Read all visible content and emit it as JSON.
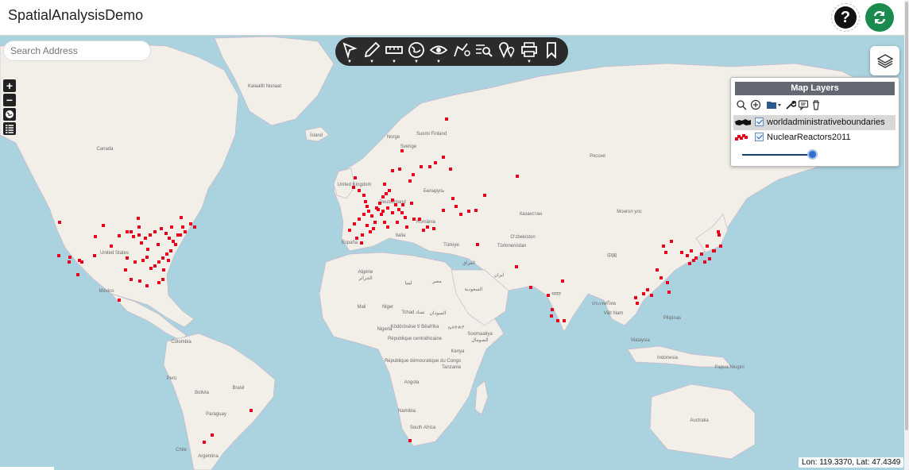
{
  "app": {
    "title": "SpatialAnalysisDemo"
  },
  "header": {
    "help_icon": "help-icon",
    "refresh_icon": "refresh-icon",
    "accent": "#1a8a4e"
  },
  "search": {
    "placeholder": "Search Address"
  },
  "toolbar": {
    "tools": [
      "select-tool-icon",
      "draw-tool-icon",
      "measure-tool-icon",
      "globe-tool-icon",
      "view-tool-icon",
      "buffer-tool-icon",
      "identify-tool-icon",
      "location-tool-icon",
      "print-tool-icon",
      "bookmark-tool-icon"
    ]
  },
  "map_controls": {
    "zoom_in": "+",
    "zoom_out": "−"
  },
  "layers": {
    "title": "Map Layers",
    "items": [
      {
        "name": "worldadministrativeboundaries",
        "checked": true
      },
      {
        "name": "NuclearReactors2011",
        "checked": true
      }
    ],
    "opacity_slider": 1.0
  },
  "coords": {
    "text": "Lon: 119.3370, Lat: 47.4349"
  },
  "map_labels": {
    "canada": "Canada",
    "kalaallit": "Kalaallit Nunaat",
    "island": "Ísland",
    "norge": "Norge",
    "suomi": "Suomi Finland",
    "sverige": "Sverige",
    "uk": "United Kingdom",
    "belarus": "Беларусь",
    "deutschland": "Deutschland",
    "romania": "România",
    "espana": "España",
    "italia": "Italia",
    "turkiye": "Türkiye",
    "russia": "Россия",
    "kazakhstan": "Казахстан",
    "mongolia": "Монгол улс",
    "uzbekistan": "Oʻzbekiston",
    "turkmenistan": "Türkmenistan",
    "iran": "ایران",
    "iraq": "العراق",
    "china": "中国",
    "usa": "United States",
    "mexico": "México",
    "algerie": "Algérie",
    "algerie_ar": "الجزائر",
    "libya": "ليبيا",
    "egypt": "مصر",
    "saudi": "السعودية",
    "mali": "Mali",
    "niger": "Niger",
    "tchad": "Tchad تشاد",
    "sudan": "السودان",
    "ethiopia": "ኢትዮጵያ",
    "somalia": "Soomaaliya",
    "somalia_ar": "الصومال",
    "nigeria": "Nigeria",
    "car": "Ködörösêse tî Bêafrîka",
    "car2": "République centrafricaine",
    "kenya": "Kenya",
    "rdc": "République démocratique du Congo",
    "tanzania": "Tanzania",
    "angola": "Angola",
    "namibia": "Namibia",
    "south_africa": "South Africa",
    "colombia": "Colombia",
    "peru": "Perú",
    "brasil": "Brasil",
    "bolivia": "Bolivia",
    "paraguay": "Paraguay",
    "chile": "Chile",
    "argentina": "Argentina",
    "thailand": "ประเทศไทย",
    "vietnam": "Việt Nam",
    "philippines": "Pilipinas",
    "malaysia": "Malaysia",
    "indonesia": "Indonesia",
    "png": "Papua Niugini",
    "australia": "Australia",
    "india": "भारत"
  },
  "reactors_legend_color": "#e8001c"
}
